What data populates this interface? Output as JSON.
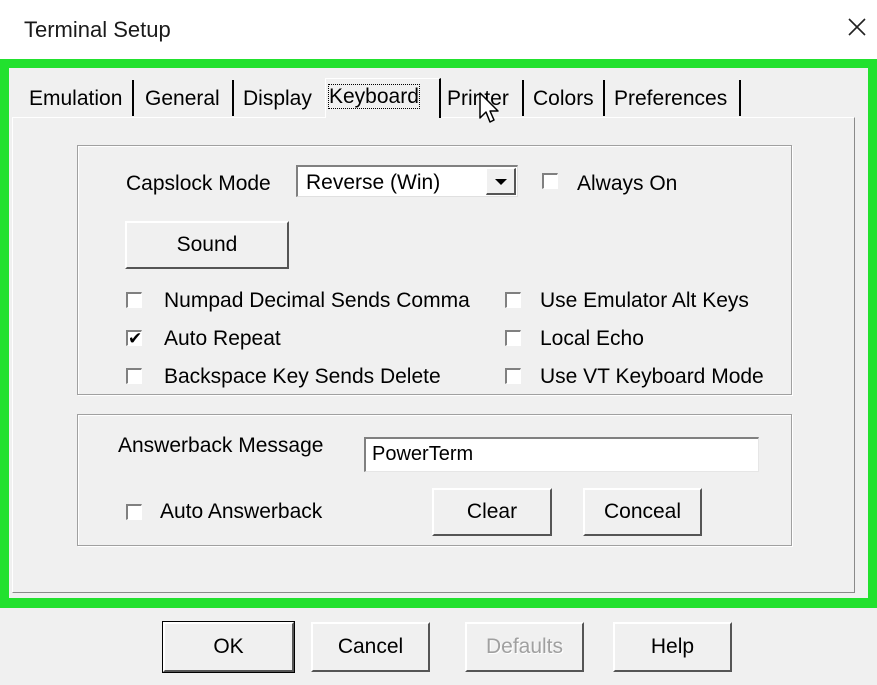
{
  "window": {
    "title": "Terminal Setup",
    "close_icon": "close-icon"
  },
  "tabs": [
    {
      "label": "Emulation"
    },
    {
      "label": "General"
    },
    {
      "label": "Display"
    },
    {
      "label": "Keyboard",
      "active": true
    },
    {
      "label": "Printer"
    },
    {
      "label": "Colors"
    },
    {
      "label": "Preferences"
    }
  ],
  "keyboard": {
    "capslock_label": "Capslock Mode",
    "capslock_value": "Reverse (Win)",
    "always_on_label": "Always On",
    "always_on_checked": false,
    "sound_label": "Sound",
    "options": {
      "numpad_decimal": {
        "label": "Numpad Decimal Sends Comma",
        "checked": false
      },
      "auto_repeat": {
        "label": "Auto Repeat",
        "checked": true
      },
      "backspace_delete": {
        "label": "Backspace Key Sends Delete",
        "checked": false
      },
      "emulator_alt": {
        "label": "Use Emulator Alt Keys",
        "checked": false
      },
      "local_echo": {
        "label": "Local Echo",
        "checked": false
      },
      "vt_keyboard": {
        "label": "Use VT Keyboard Mode",
        "checked": false
      }
    }
  },
  "answerback": {
    "message_label": "Answerback Message",
    "message_value": "PowerTerm",
    "auto_label": "Auto Answerback",
    "auto_checked": false,
    "clear_label": "Clear",
    "conceal_label": "Conceal"
  },
  "footer": {
    "ok_label": "OK",
    "cancel_label": "Cancel",
    "defaults_label": "Defaults",
    "help_label": "Help"
  },
  "colors": {
    "highlight": "#22e12e",
    "dialog_bg": "#f0f0f0"
  }
}
